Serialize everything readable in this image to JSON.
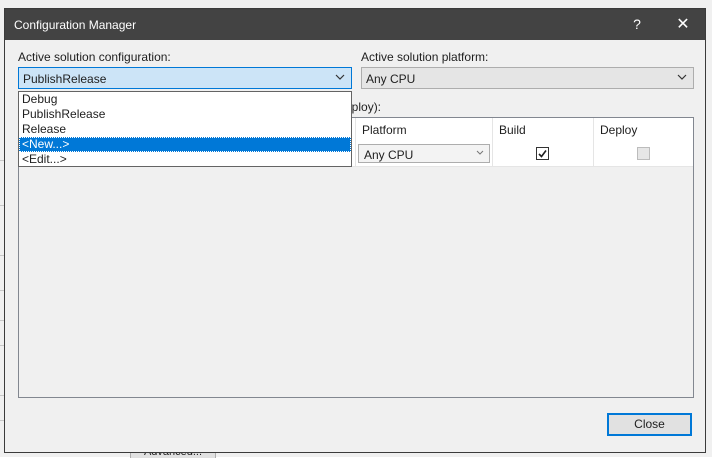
{
  "background": {
    "advanced_button_label": "Advanced..."
  },
  "window": {
    "title": "Configuration Manager",
    "help_glyph": "?",
    "close_glyph": "✕"
  },
  "active_config": {
    "label": "Active solution configuration:",
    "value": "PublishRelease",
    "options": [
      "Debug",
      "PublishRelease",
      "Release",
      "<New...>",
      "<Edit...>"
    ],
    "highlighted_option": "<New...>"
  },
  "active_platform": {
    "label": "Active solution platform:",
    "value": "Any CPU"
  },
  "contexts": {
    "partial_label": "eploy):",
    "columns": [
      "Platform",
      "Build",
      "Deploy"
    ],
    "rows": [
      {
        "platform": "Any CPU",
        "build": true,
        "deploy": false
      }
    ]
  },
  "footer": {
    "close_label": "Close"
  },
  "colors": {
    "titlebar": "#434343",
    "accent": "#0078d7",
    "dialog_bg": "#f0f0f0"
  }
}
